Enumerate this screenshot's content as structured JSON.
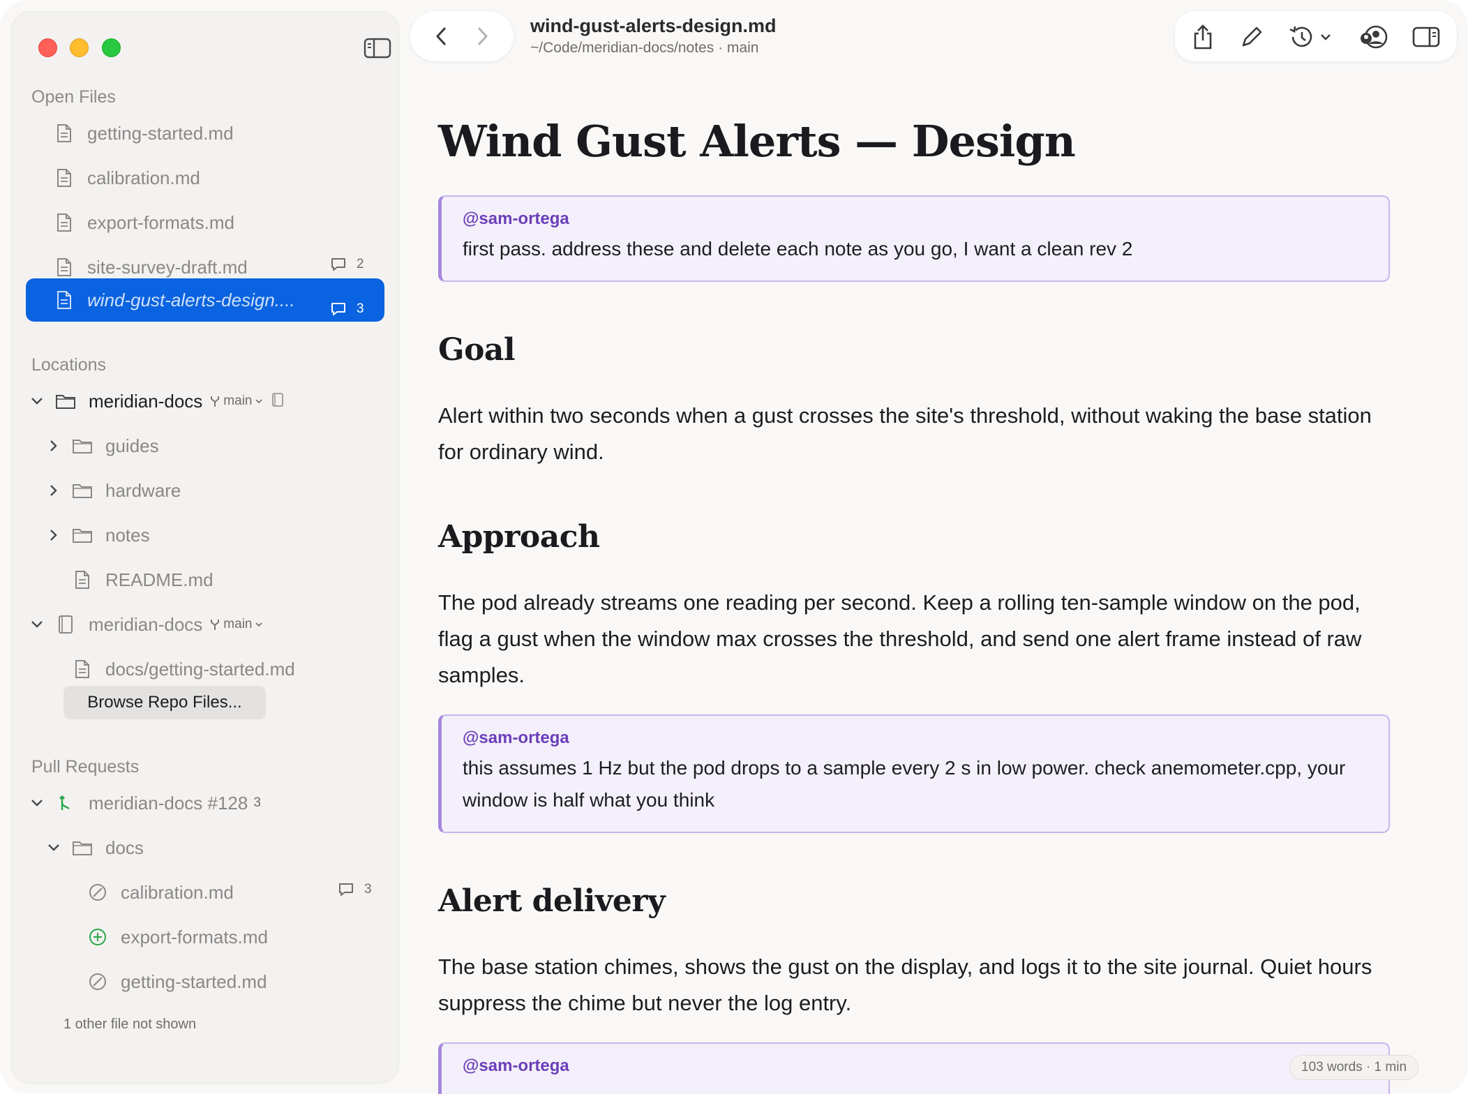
{
  "window": {
    "file_title": "wind-gust-alerts-design.md",
    "file_path": "~/Code/meridian-docs/notes · main"
  },
  "sidebar": {
    "open_files_title": "Open Files",
    "open_files": [
      {
        "name": "getting-started.md",
        "comments": ""
      },
      {
        "name": "calibration.md",
        "comments": ""
      },
      {
        "name": "export-formats.md",
        "comments": ""
      },
      {
        "name": "site-survey-draft.md",
        "comments": "2"
      },
      {
        "name": "wind-gust-alerts-design....",
        "comments": "3",
        "selected": true
      }
    ],
    "locations_title": "Locations",
    "repo1": {
      "name": "meridian-docs",
      "branch": "main"
    },
    "repo1_children": [
      "guides",
      "hardware",
      "notes",
      "README.md"
    ],
    "repo2": {
      "name": "meridian-docs",
      "branch": "main"
    },
    "repo2_file": "docs/getting-started.md",
    "browse_button": "Browse Repo Files...",
    "pull_requests_title": "Pull Requests",
    "pr": {
      "name": "meridian-docs #128",
      "count": "3"
    },
    "pr_folder": "docs",
    "pr_files": [
      {
        "name": "calibration.md",
        "status": "modified",
        "comments": "3"
      },
      {
        "name": "export-formats.md",
        "status": "added",
        "comments": ""
      },
      {
        "name": "getting-started.md",
        "status": "modified",
        "comments": ""
      }
    ],
    "hidden_note": "1 other file not shown"
  },
  "document": {
    "title": "Wind Gust Alerts — Design",
    "note1": {
      "author": "@sam-ortega",
      "text": "first pass. address these and delete each note as you go, I want a clean rev 2"
    },
    "h_goal": "Goal",
    "goal_text": "Alert within two seconds when a gust crosses the site's threshold, without waking the base station for ordinary wind.",
    "h_approach": "Approach",
    "approach_text": "The pod already streams one reading per second. Keep a rolling ten-sample window on the pod, flag a gust when the window max crosses the threshold, and send one alert frame instead of raw samples.",
    "note2": {
      "author": "@sam-ortega",
      "text": "this assumes 1 Hz but the pod drops to a sample every 2 s in low power. check anemometer.cpp, your window is half what you think"
    },
    "h_delivery": "Alert delivery",
    "delivery_text": "The base station chimes, shows the gust on the display, and logs it to the site journal. Quiet hours suppress the chime but never the log entry.",
    "note3": {
      "author": "@sam-ortega"
    },
    "stats": "103 words · 1 min"
  },
  "colors": {
    "accent": "#0a63e0",
    "note_border": "#a688dc",
    "note_author": "#6b3fb8",
    "added_status": "#28a745"
  }
}
